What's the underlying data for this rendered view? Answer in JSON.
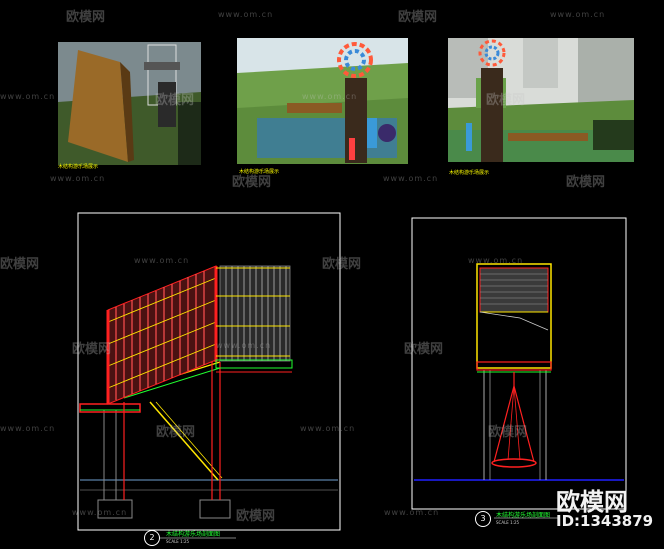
{
  "photos": [
    {
      "caption": "木结构游乐场展示"
    },
    {
      "caption": "木结构游乐场展示"
    },
    {
      "caption": "木结构游乐场展示"
    }
  ],
  "drawings": [
    {
      "number": "2",
      "title": "木结构游乐场剖面图",
      "scale": "SCALE 1:25"
    },
    {
      "number": "3",
      "title": "木结构游乐场剖面图",
      "scale": "SCALE 1:25"
    }
  ],
  "watermark": {
    "logo": "欧模网",
    "url": "www.om.cn"
  },
  "badge": {
    "logo": "欧模网",
    "id": "ID:1343879"
  },
  "colors": {
    "line_red": "#ff2020",
    "line_yellow": "#ffe600",
    "line_green": "#20ff30",
    "line_blue": "#2020ff",
    "frame": "#ffffff"
  }
}
